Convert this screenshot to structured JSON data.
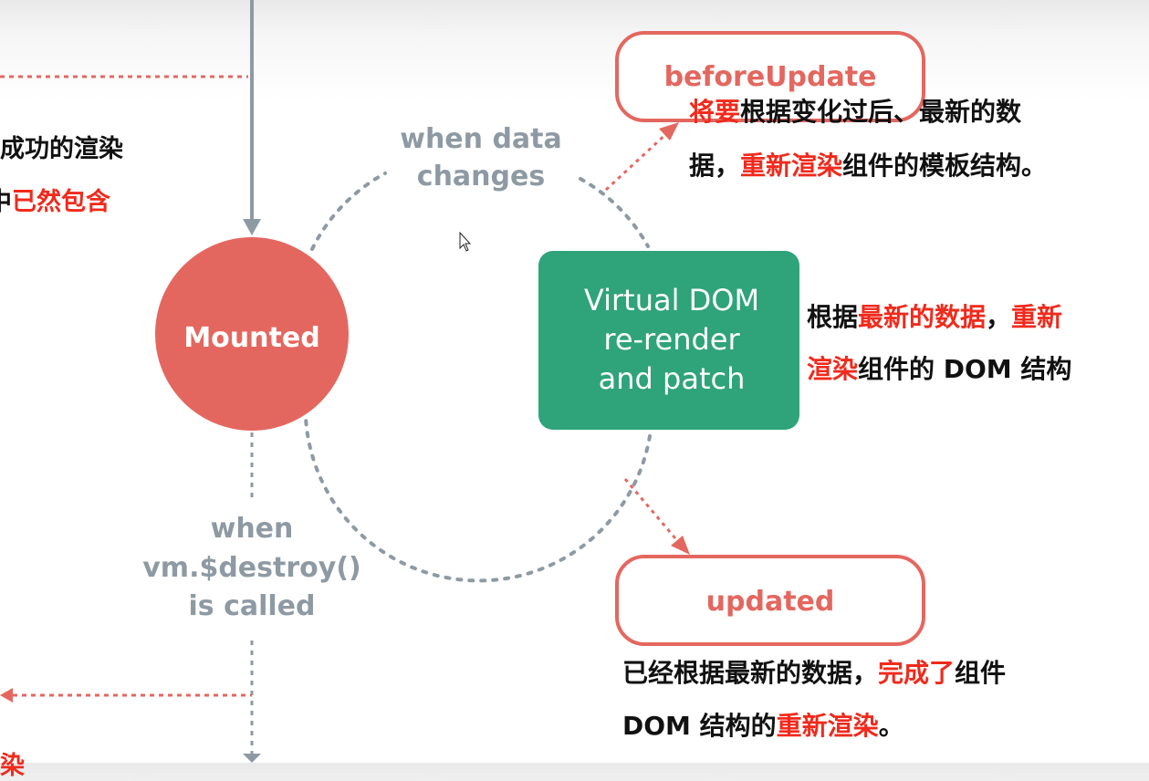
{
  "nodes": {
    "mounted": "Mounted",
    "before_update": "beforeUpdate",
    "vdom": [
      "Virtual DOM",
      "re-render",
      "and patch"
    ],
    "updated": "updated"
  },
  "labels": {
    "when_data_changes": [
      "when data",
      "changes"
    ],
    "when_destroy": [
      "when",
      "vm.$destroy()",
      "is called"
    ]
  },
  "texts": {
    "left_partial": {
      "line1": "成功的渲染",
      "line2_black": "中",
      "line2_red": "已然包含",
      "bottom_char": "染"
    },
    "before_update_desc": {
      "line1_red": "将要",
      "line1_black": "根据变化过后、最新的数",
      "line2_a": "据，",
      "line2_red": "重新渲染",
      "line2_b": "组件的模板结构。"
    },
    "vdom_desc": {
      "line1_a": "根据",
      "line1_red": "最新的数据",
      "line1_b": "，",
      "line1_red2": "重新",
      "line2_red": "渲染",
      "line2_b": "组件的 DOM 结构"
    },
    "updated_desc": {
      "line1_a": "已经根据最新的数据，",
      "line1_red": "完成了",
      "line1_b": "组件",
      "line2_a": "DOM 结构的",
      "line2_red": "重新渲染",
      "line2_b": "。"
    }
  },
  "colors": {
    "mounted_fill": "#e4675f",
    "hook_border": "#e4675f",
    "hook_text": "#e4675f",
    "vdom_fill": "#2fa37a",
    "gray_line": "#8e9aa3",
    "red_dotted": "#e4675f",
    "highlight_red": "#f02a1c"
  }
}
